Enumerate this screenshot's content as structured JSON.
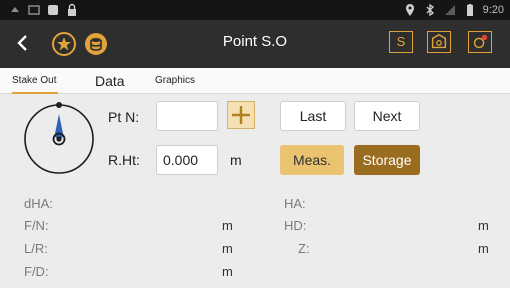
{
  "status_bar": {
    "time": "9:20",
    "left_icons": [
      "notification-icon",
      "screen-icon",
      "square-icon",
      "lock-icon"
    ],
    "right_icons": [
      "location-icon",
      "bluetooth-icon",
      "signal-icon",
      "battery-icon"
    ]
  },
  "app_bar": {
    "title": "Point S.O",
    "btn_s": "S",
    "colors": {
      "background": "#2e2e2e",
      "accent": "#e0a33a"
    }
  },
  "tabs": [
    {
      "label": "Stake Out",
      "active": true
    },
    {
      "label": "Data",
      "active": false
    },
    {
      "label": "Graphics",
      "active": false
    }
  ],
  "form": {
    "pt_label": "Pt N:",
    "pt_value": "",
    "rht_label": "R.Ht:",
    "rht_value": "0.000",
    "rht_unit": "m",
    "last_label": "Last",
    "next_label": "Next",
    "meas_label": "Meas.",
    "storage_label": "Storage"
  },
  "results": {
    "left": [
      {
        "label": "dHA:",
        "unit": ""
      },
      {
        "label": "F/N:",
        "unit": "m"
      },
      {
        "label": "L/R:",
        "unit": "m"
      },
      {
        "label": "F/D:",
        "unit": "m"
      }
    ],
    "right": [
      {
        "label": "HA:",
        "unit": ""
      },
      {
        "label": "HD:",
        "unit": "m"
      },
      {
        "label": "Z:",
        "unit": "m"
      }
    ]
  },
  "colors": {
    "meas_bg": "#e9c36f",
    "storage_bg": "#9a6c1f"
  }
}
